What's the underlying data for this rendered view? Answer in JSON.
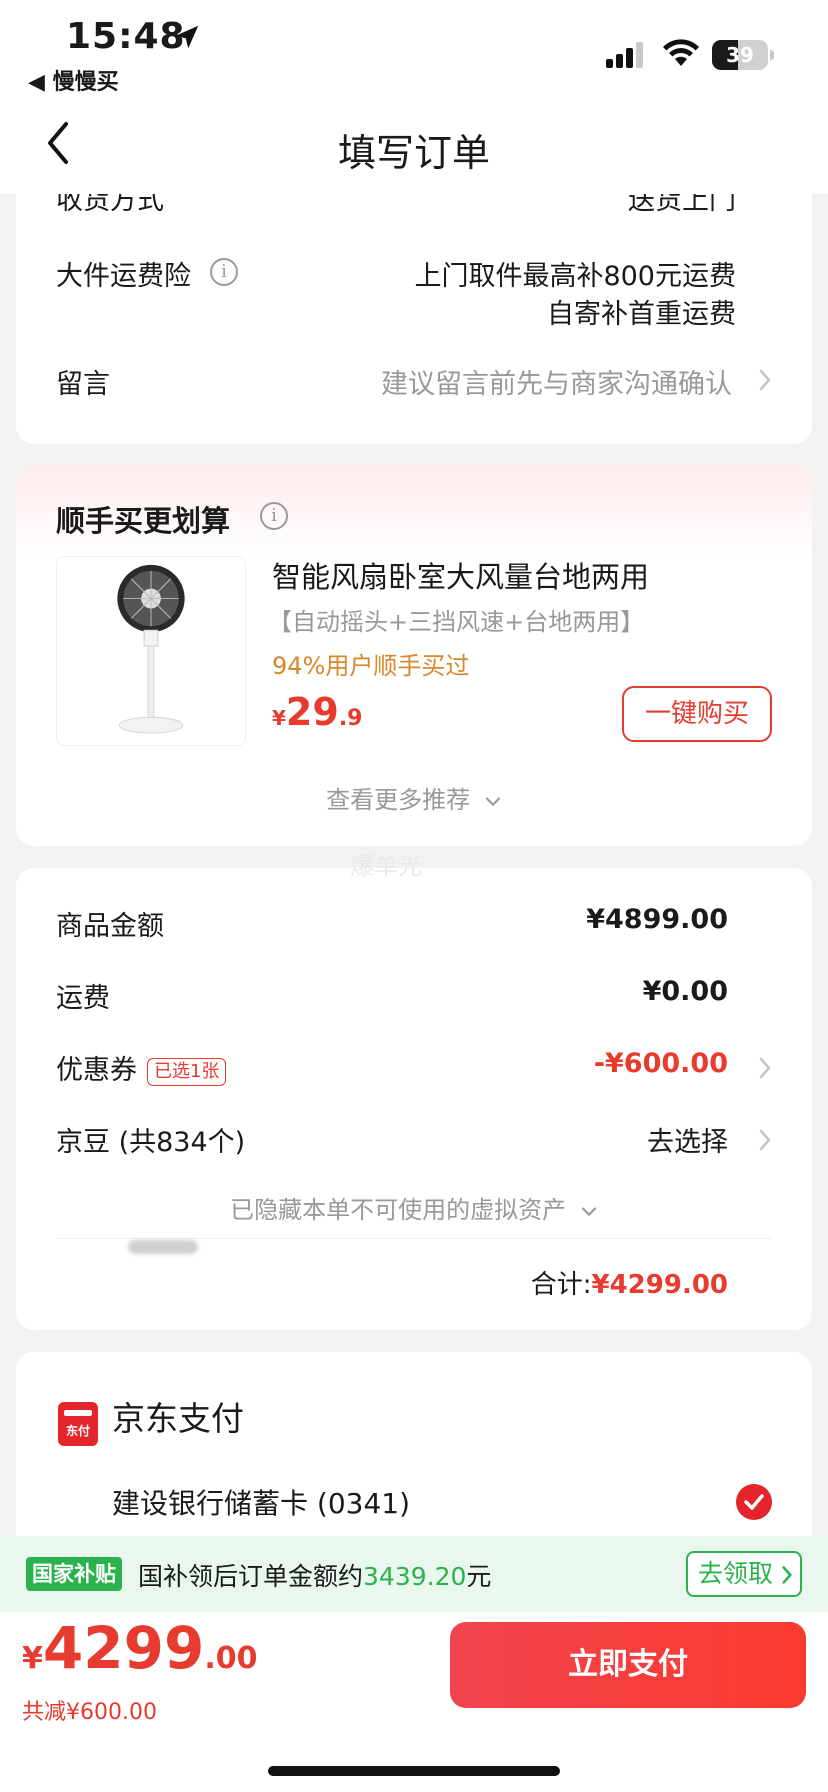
{
  "status_bar": {
    "time": "15:48",
    "back_app": "◀ 慢慢买",
    "battery": "39"
  },
  "nav": {
    "title": "填写订单"
  },
  "delivery": {
    "partial_label": "收货方式",
    "partial_value": "送货上门",
    "insurance_label": "大件运费险",
    "insurance_line1": "上门取件最高补800元运费",
    "insurance_line2": "自寄补首重运费",
    "message_label": "留言",
    "message_placeholder": "建议留言前先与商家沟通确认"
  },
  "recommend": {
    "title": "顺手买更划算",
    "product_name": "智能风扇卧室大风量台地两用",
    "product_tags": "【自动摇头+三挡风速+台地两用】",
    "social_proof": "94%用户顺手买过",
    "price_symbol": "¥",
    "price_int": "29",
    "price_dec": ".9",
    "buy_label": "一键购买",
    "more_label": "查看更多推荐"
  },
  "watermark": "爆单光",
  "summary": {
    "goods_label": "商品金额",
    "goods_value": "¥4899.00",
    "shipping_label": "运费",
    "shipping_value": "¥0.00",
    "coupon_label": "优惠券",
    "coupon_tag": "已选1张",
    "coupon_value": "-¥600.00",
    "beans_label": "京豆 (共834个)",
    "beans_value": "去选择",
    "hidden_assets": "已隐藏本单不可使用的虚拟资产",
    "total_label": "合计:",
    "total_value": "¥4299.00"
  },
  "payment": {
    "method": "京东支付",
    "icon_text": "东付",
    "card": "建设银行储蓄卡 (0341)"
  },
  "subsidy": {
    "badge": "国家补贴",
    "text_prefix": "国补领后订单金额约",
    "amount": "3439.20",
    "text_suffix": "元",
    "claim": "去领取"
  },
  "bottom": {
    "price_symbol": "¥",
    "price_int": "4299",
    "price_dec": ".00",
    "discount": "共减¥600.00",
    "pay_label": "立即支付"
  },
  "colors": {
    "accent_red": "#e63b2e",
    "green": "#2bb24c",
    "orange_text": "#d6882a",
    "background": "#f2f2f2"
  }
}
